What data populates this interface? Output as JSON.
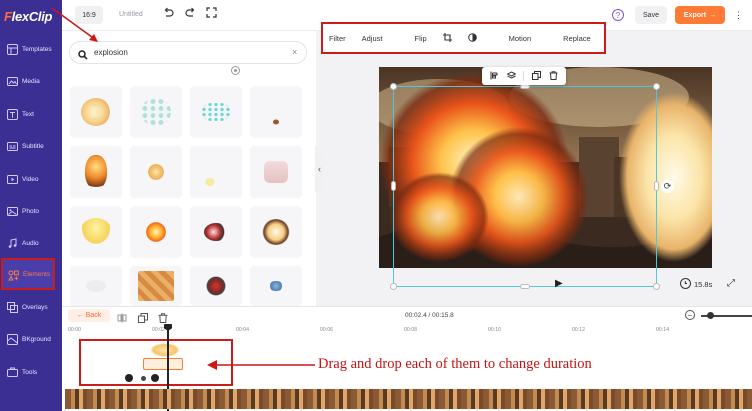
{
  "app": {
    "logo_text_a": "F",
    "logo_text_b": "lexClip",
    "brand_color": "#3c2f94",
    "accent_color": "#ff7a35"
  },
  "sidebar": {
    "items": [
      {
        "label": "Templates",
        "icon": "templates-icon"
      },
      {
        "label": "Media",
        "icon": "media-icon"
      },
      {
        "label": "Text",
        "icon": "text-icon"
      },
      {
        "label": "Subtitle",
        "icon": "subtitle-icon"
      },
      {
        "label": "Video",
        "icon": "video-icon"
      },
      {
        "label": "Photo",
        "icon": "photo-icon"
      },
      {
        "label": "Audio",
        "icon": "audio-icon"
      },
      {
        "label": "Elements",
        "icon": "elements-icon",
        "active": true
      },
      {
        "label": "Overlays",
        "icon": "overlays-icon"
      },
      {
        "label": "BKground",
        "icon": "background-icon"
      },
      {
        "label": "Tools",
        "icon": "tools-icon"
      }
    ]
  },
  "topbar": {
    "ratio": "16:9",
    "title": "Untitled",
    "help": "?",
    "save_label": "Save",
    "export_label": "Export",
    "export_arrow": "→",
    "more": "⋮"
  },
  "search": {
    "value": "explosion",
    "clear": "×"
  },
  "edit_toolbar": {
    "filter": "Filter",
    "adjust": "Adjust",
    "flip": "Flip",
    "motion": "Motion",
    "replace": "Replace"
  },
  "canvas": {
    "duration": "15.8s",
    "play": "▶",
    "rotate": "⟳",
    "collapse": "‹",
    "fullscreen": "⤢"
  },
  "timeline": {
    "back_label": "← Back",
    "current_time": "00:02.4 / 00:15.8",
    "zoom_minus": "−",
    "ticks": [
      "00:00",
      "00:02",
      "00:04",
      "00:06",
      "00:08",
      "00:10",
      "00:12",
      "00:14"
    ]
  },
  "annotation": {
    "text": "Drag and drop each of them to change duration"
  }
}
